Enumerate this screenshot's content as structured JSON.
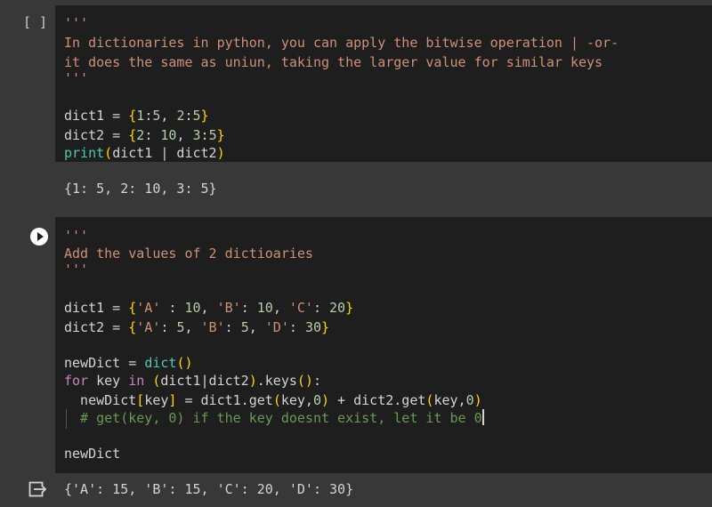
{
  "cell1": {
    "run_indicator": "[ ]",
    "doc_open": "'''",
    "doc_line1": "In dictionaries in python, you can apply the bitwise operation | -or-",
    "doc_line2": "it does the same as uniun, taking the larger value for similar keys",
    "doc_close": "'''",
    "code": {
      "l1": {
        "a": "dict1 = ",
        "b": "{",
        "c": "1",
        "d": ":",
        "e": "5",
        "f": ", ",
        "g": "2",
        "h": ":",
        "i": "5",
        "j": "}"
      },
      "l2": {
        "a": "dict2 = ",
        "b": "{",
        "c": "2",
        "d": ": ",
        "e": "10",
        "f": ", ",
        "g": "3",
        "h": ":",
        "i": "5",
        "j": "}"
      },
      "l3": {
        "a": "print",
        "b": "(",
        "c": "dict1 | dict2",
        "d": ")"
      }
    },
    "output": "{1: 5, 2: 10, 3: 5}"
  },
  "cell2": {
    "doc_open": "'''",
    "doc_line1": "Add the values of 2 dictioaries",
    "doc_close": "'''",
    "code": {
      "l1": {
        "a": "dict1 = ",
        "b": "{",
        "c": "'A'",
        "d": " : ",
        "e": "10",
        "f": ", ",
        "g": "'B'",
        "h": ": ",
        "i": "10",
        "j": ", ",
        "k": "'C'",
        "l": ": ",
        "m": "20",
        "n": "}"
      },
      "l2": {
        "a": "dict2 = ",
        "b": "{",
        "c": "'A'",
        "d": ": ",
        "e": "5",
        "f": ", ",
        "g": "'B'",
        "h": ": ",
        "i": "5",
        "j": ", ",
        "k": "'D'",
        "l": ": ",
        "m": "30",
        "n": "}"
      },
      "l3": {
        "a": "newDict = ",
        "b": "dict",
        "c": "()"
      },
      "l4": {
        "a": "for",
        "b": " key ",
        "c": "in",
        "d": " ",
        "e": "(",
        "f": "dict1|dict2",
        "g": ")",
        "h": ".keys",
        "i": "()",
        "j": ":"
      },
      "l5": {
        "a": "  newDict",
        "b": "[",
        "c": "key",
        "d": "]",
        "e": " = dict1.get",
        "f": "(",
        "g": "key,",
        "h": "0",
        "i": ")",
        "j": " + dict2.get",
        "k": "(",
        "l": "key,",
        "m": "0",
        "n": ")"
      },
      "l6": {
        "a": "  # get(key, 0) if the key doesnt exist, let it be 0"
      },
      "l7": {
        "a": "newDict"
      }
    },
    "output": "{'A': 15, 'B': 15, 'C': 20, 'D': 30}"
  },
  "icons": {
    "run": "play-icon",
    "output": "output-redirect-icon"
  },
  "colors": {
    "background": "#383838",
    "editor": "#1e1e1e",
    "string": "#ce9178",
    "number": "#b5cea8",
    "bracket": "#ffd700",
    "builtin": "#4ec9b0",
    "keyword": "#c586c0",
    "comment": "#6a9955"
  }
}
